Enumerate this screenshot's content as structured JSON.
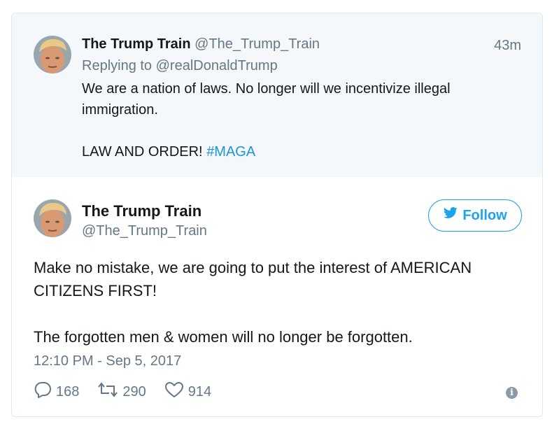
{
  "parent_tweet": {
    "name": "The Trump Train",
    "handle": "@The_Trump_Train",
    "time": "43m",
    "replying_to": "Replying to @realDonaldTrump",
    "text_line1": "We are a nation of laws. No longer will we incentivize illegal",
    "text_line2": "immigration.",
    "text_line3": "LAW AND ORDER! ",
    "hashtag": "#MAGA"
  },
  "main_tweet": {
    "name": "The Trump Train",
    "handle": "@The_Trump_Train",
    "follow_label": "Follow",
    "text_line1": "Make no mistake, we are going to put the interest of AMERICAN",
    "text_line2": "CITIZENS FIRST!",
    "text_line3": "The forgotten men & women will no longer be forgotten.",
    "timestamp": "12:10 PM - Sep 5, 2017",
    "replies": "168",
    "retweets": "290",
    "likes": "914"
  },
  "icons": {
    "reply": "reply-icon",
    "retweet": "retweet-icon",
    "like": "heart-icon",
    "info": "info-icon",
    "bird": "twitter-bird-icon"
  },
  "colors": {
    "accent": "#1da1f2",
    "hashtag": "#1b95e0",
    "muted": "#657786",
    "parent_bg": "#f5f8fa"
  }
}
